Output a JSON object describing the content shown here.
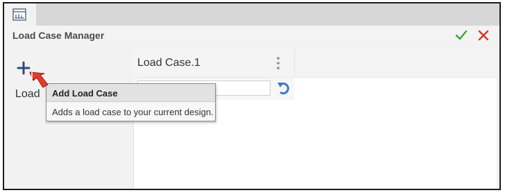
{
  "window": {
    "title": "Load Case Manager",
    "doc_tab_icon": "document-icon",
    "ok_icon": "checkmark-icon",
    "cancel_icon": "close-icon",
    "accent_ok": "#3aa53a",
    "accent_cancel": "#d9342b"
  },
  "left_panel": {
    "add_icon": "plus-icon",
    "items": [
      {
        "label": "Load"
      }
    ]
  },
  "load_case": {
    "header_label": "Load Case.1",
    "menu_icon": "kebab-icon",
    "name_value": "",
    "reset_icon": "undo-icon"
  },
  "tooltip": {
    "title": "Add Load Case",
    "description": "Adds a load case to your current design."
  },
  "cursor": {
    "icon": "hand-pointer-icon"
  }
}
